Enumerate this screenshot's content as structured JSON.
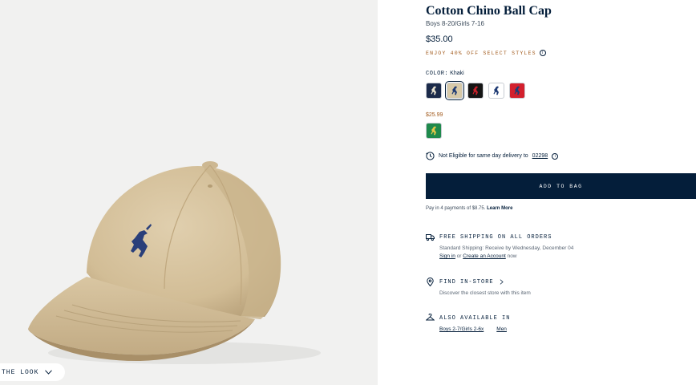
{
  "image": {
    "shop_the_look_label": "THE LOOK"
  },
  "product": {
    "title": "Cotton Chino Ball Cap",
    "subtitle": "Boys 8-20/Girls 7-16",
    "price": "$35.00",
    "promo": "ENJOY 40% OFF SELECT STYLES",
    "color_label": "COLOR:",
    "color_value": "Khaki",
    "swatches": [
      {
        "name": "navy",
        "bg": "#1b2a4a",
        "pony": "#e8e2d0"
      },
      {
        "name": "khaki",
        "bg": "#d7c9a8",
        "pony": "#1f3b74",
        "selected": true
      },
      {
        "name": "black",
        "bg": "#151515",
        "pony": "#c8202a"
      },
      {
        "name": "white",
        "bg": "#ffffff",
        "pony": "#1f3b74"
      },
      {
        "name": "red",
        "bg": "#d3202d",
        "pony": "#1f3b74"
      }
    ],
    "alt_price": "$25.99",
    "alt_swatch": {
      "name": "green",
      "bg": "#1f8a4c",
      "pony": "#e3c84a"
    },
    "delivery_text": "Not Eligible for same day delivery to",
    "zip": "02298",
    "add_to_bag": "ADD TO BAG",
    "pay_text": "Pay in 4 payments of $8.75.",
    "learn_more": "Learn More"
  },
  "services": {
    "shipping": {
      "title": "FREE SHIPPING ON ALL ORDERS",
      "detail": "Standard Shipping: Receive by Wednesday, December 04",
      "sign_in": "Sign in",
      "or": "or",
      "create_account": "Create an Account",
      "now": "now"
    },
    "store": {
      "title": "FIND IN-STORE",
      "detail": "Discover the closest store with this item"
    },
    "also": {
      "title": "ALSO AVAILABLE IN",
      "links": [
        "Boys 2-7/Girls 2-6x",
        "Men"
      ]
    }
  },
  "colors": {
    "navy": "#041e3a",
    "promo": "#a0581a",
    "image_bg": "#f1f1f0"
  }
}
